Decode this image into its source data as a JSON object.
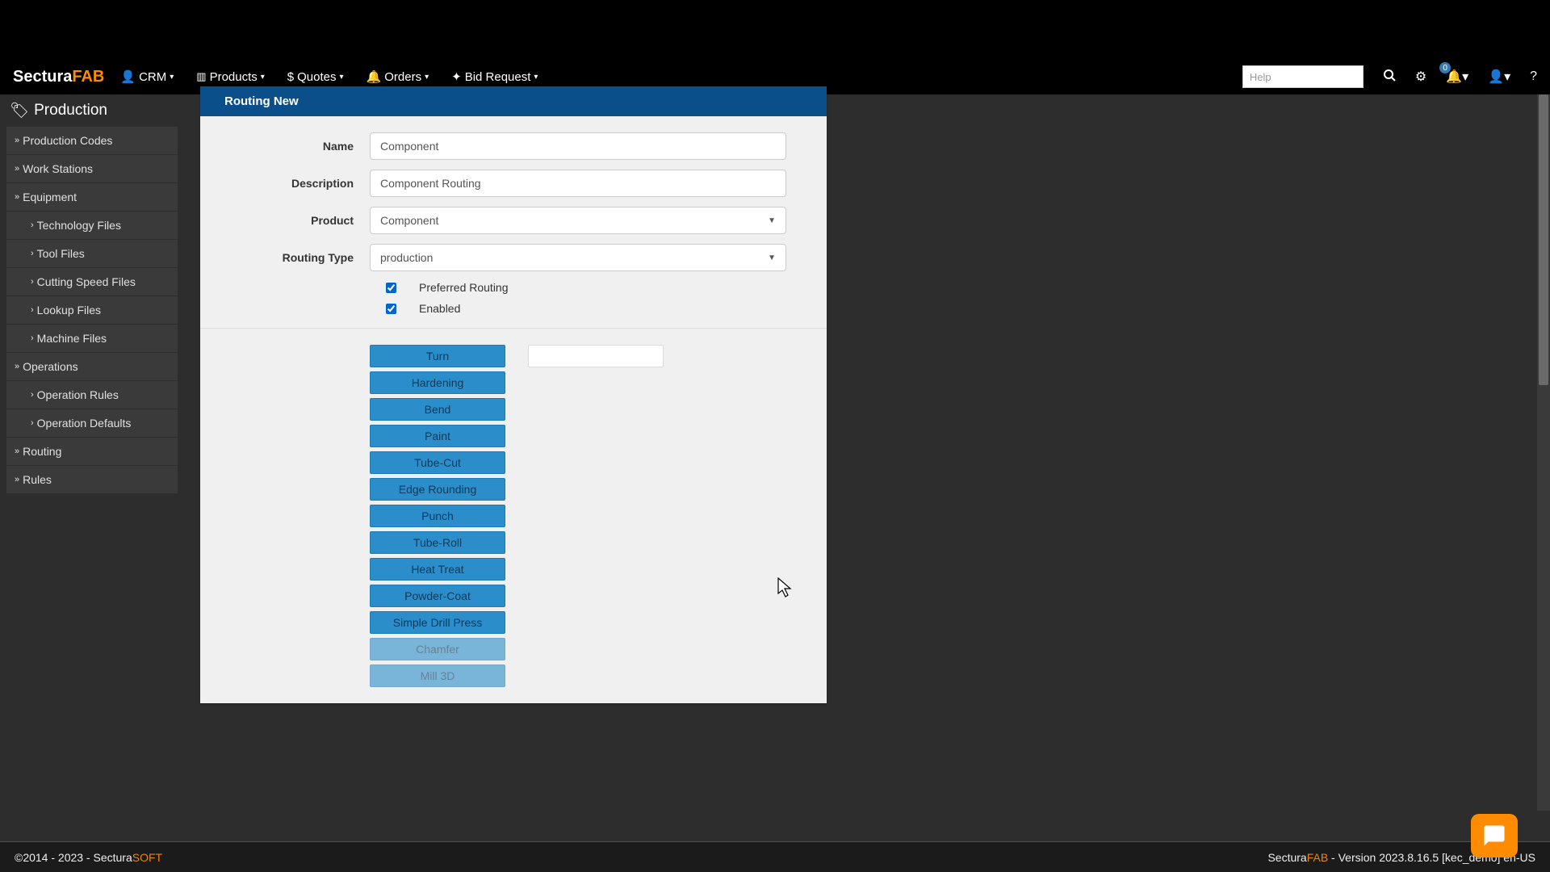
{
  "brand": {
    "a": "Sectura",
    "b": "FAB"
  },
  "nav": {
    "crm": "CRM",
    "products": "Products",
    "quotes": "Quotes",
    "orders": "Orders",
    "bid": "Bid Request"
  },
  "search": {
    "placeholder": "Help"
  },
  "notifications": {
    "count": "0"
  },
  "sidebar": {
    "header": "Production",
    "items": [
      {
        "label": "Production Codes",
        "sub": false
      },
      {
        "label": "Work Stations",
        "sub": false
      },
      {
        "label": "Equipment",
        "sub": false
      },
      {
        "label": "Technology Files",
        "sub": true
      },
      {
        "label": "Tool Files",
        "sub": true
      },
      {
        "label": "Cutting Speed Files",
        "sub": true
      },
      {
        "label": "Lookup Files",
        "sub": true
      },
      {
        "label": "Machine Files",
        "sub": true
      },
      {
        "label": "Operations",
        "sub": false
      },
      {
        "label": "Operation Rules",
        "sub": true
      },
      {
        "label": "Operation Defaults",
        "sub": true
      },
      {
        "label": "Routing",
        "sub": false
      },
      {
        "label": "Rules",
        "sub": false
      }
    ]
  },
  "panel": {
    "title": "Routing New",
    "labels": {
      "name": "Name",
      "description": "Description",
      "product": "Product",
      "routing_type": "Routing Type"
    },
    "values": {
      "name": "Component",
      "description": "Component Routing",
      "product": "Component",
      "routing_type": "production"
    },
    "checks": {
      "preferred": "Preferred Routing",
      "enabled": "Enabled"
    },
    "operations": [
      "Turn",
      "Hardening",
      "Bend",
      "Paint",
      "Tube-Cut",
      "Edge Rounding",
      "Punch",
      "Tube-Roll",
      "Heat Treat",
      "Powder-Coat",
      "Simple Drill Press",
      "Chamfer",
      "Mill 3D"
    ]
  },
  "footer": {
    "copyright": "©2014 - 2023 - ",
    "brand_a": "Sectura",
    "brand_b": "SOFT",
    "right_a": "Sectura",
    "right_b": "FAB",
    "version": " - Version 2023.8.16.5 [kec_demo] en-US"
  }
}
